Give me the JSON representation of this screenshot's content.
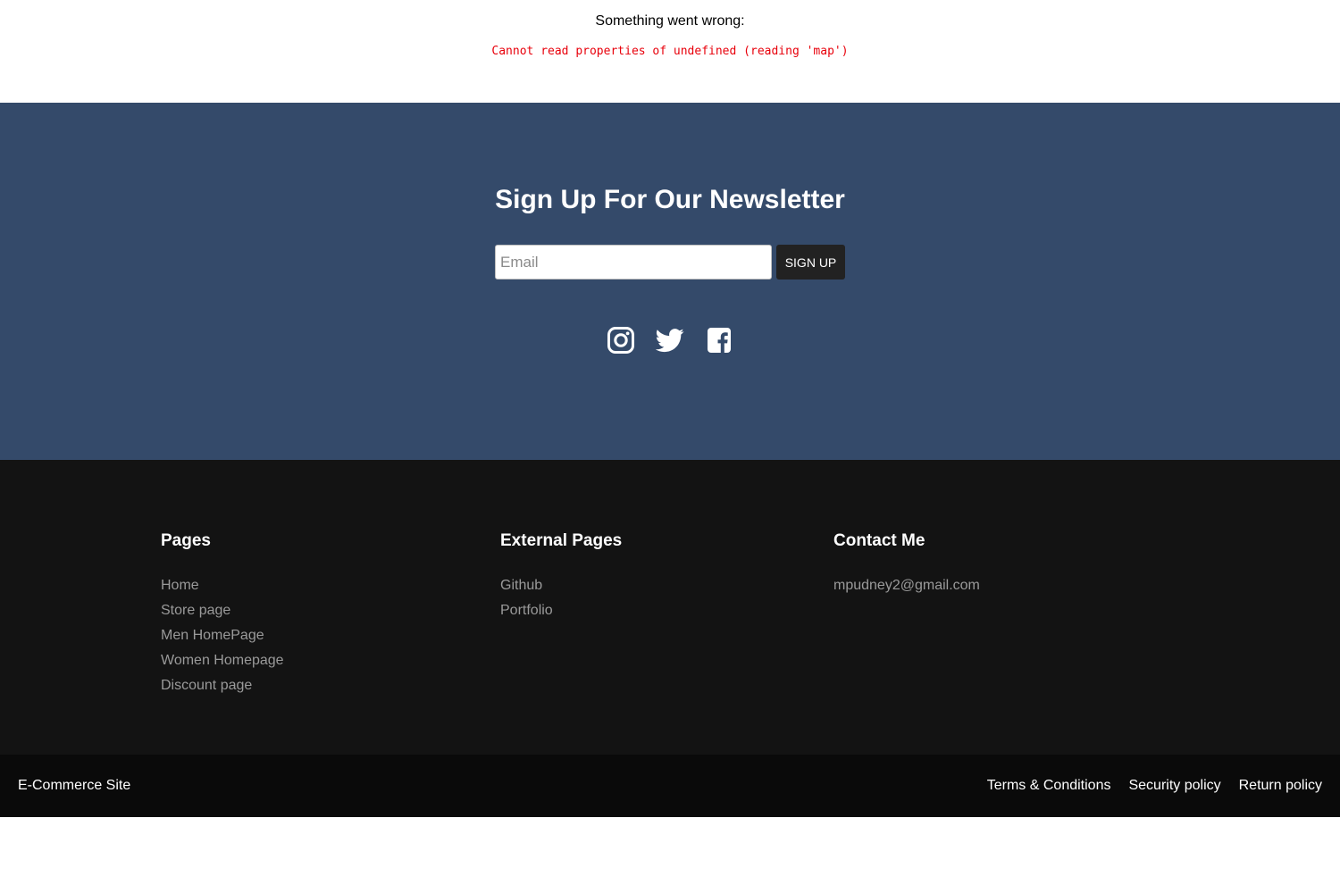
{
  "error": {
    "title": "Something went wrong:",
    "message": "Cannot read properties of undefined (reading 'map')"
  },
  "newsletter": {
    "title": "Sign Up For Our Newsletter",
    "email_placeholder": "Email",
    "signup_label": "SIGN UP",
    "background_color": "#344a6a",
    "social_icons": [
      "instagram-icon",
      "twitter-icon",
      "facebook-icon"
    ]
  },
  "footer": {
    "pages": {
      "heading": "Pages",
      "links": [
        "Home",
        "Store page",
        "Men HomePage",
        "Women Homepage",
        "Discount page"
      ]
    },
    "external": {
      "heading": "External Pages",
      "links": [
        "Github",
        "Portfolio"
      ]
    },
    "contact": {
      "heading": "Contact Me",
      "email": "mpudney2@gmail.com"
    }
  },
  "bottom_bar": {
    "brand": "E-Commerce Site",
    "links": [
      "Terms & Conditions",
      "Security policy",
      "Return policy"
    ]
  }
}
